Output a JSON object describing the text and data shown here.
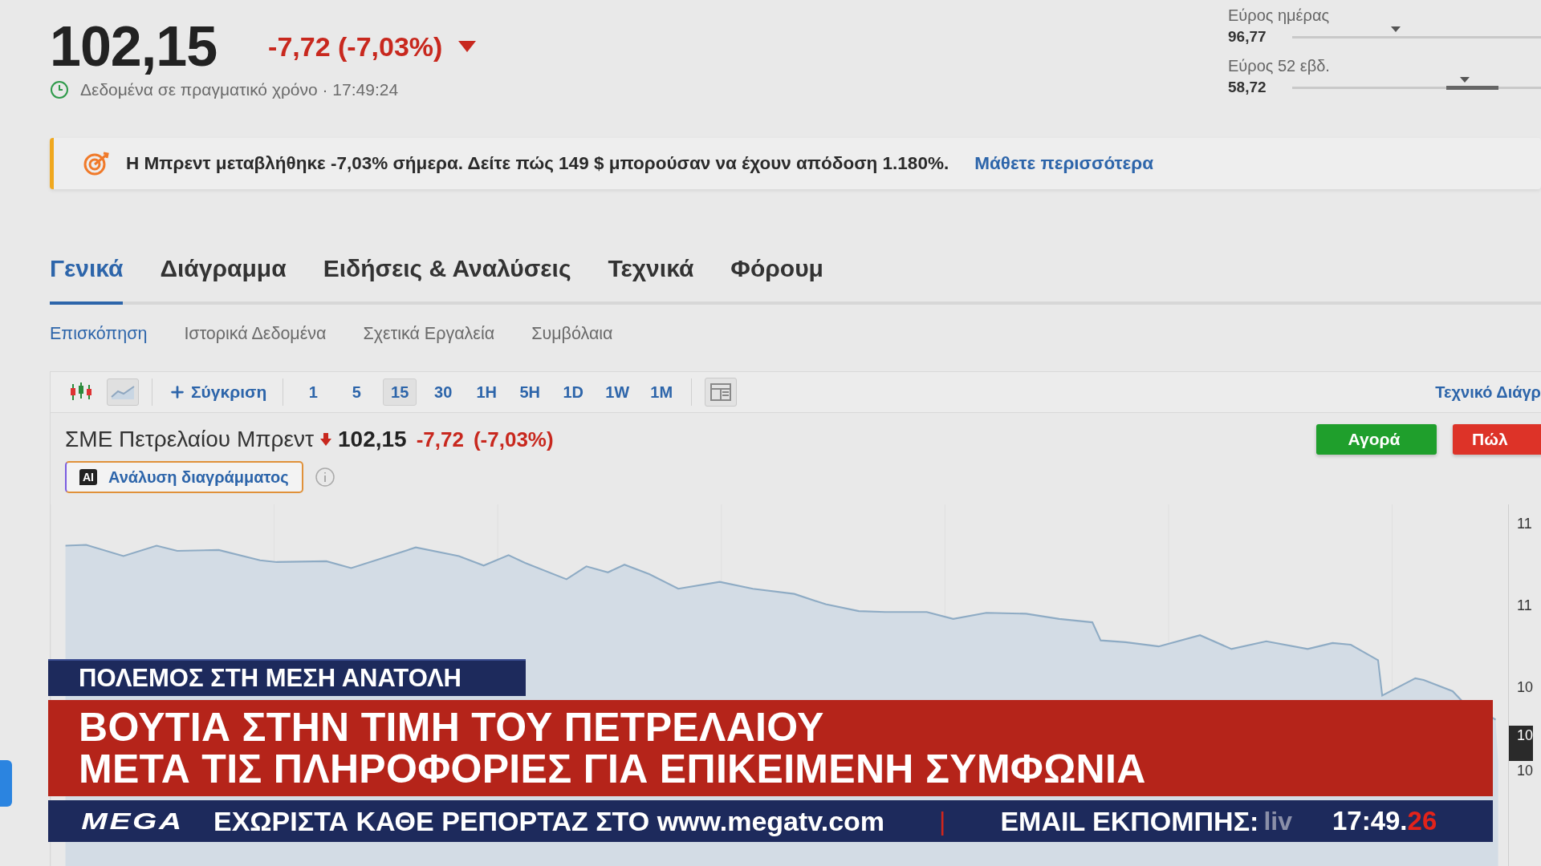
{
  "quote": {
    "price": "102,15",
    "change": "-7,72 (-7,03%)",
    "falling": true,
    "realtime_label": "Δεδομένα σε πραγματικό χρόνο · 17:49:24"
  },
  "ranges": [
    {
      "label": "Εύρος ημέρας",
      "low": "96,77",
      "kind": "marker",
      "level": 0.39
    },
    {
      "label": "Εύρος 52 εβδ.",
      "low": "58,72",
      "kind": "band",
      "level": 0.65
    }
  ],
  "promo": {
    "text": "Η Μπρεντ μεταβλήθηκε -7,03% σήμερα. Δείτε πώς 149 $ μπορούσαν να έχουν απόδοση 1.180%.",
    "link": "Μάθετε περισσότερα"
  },
  "tabs": [
    {
      "label": "Γενικά",
      "selected": true
    },
    {
      "label": "Διάγραμμα",
      "selected": false
    },
    {
      "label": "Ειδήσεις & Αναλύσεις",
      "selected": false
    },
    {
      "label": "Τεχνικά",
      "selected": false
    },
    {
      "label": "Φόρουμ",
      "selected": false
    }
  ],
  "subtabs": [
    {
      "label": "Επισκόπηση",
      "selected": true
    },
    {
      "label": "Ιστορικά Δεδομένα",
      "selected": false
    },
    {
      "label": "Σχετικά Εργαλεία",
      "selected": false
    },
    {
      "label": "Συμβόλαια",
      "selected": false
    }
  ],
  "toolbar": {
    "chart_types": [
      {
        "kind": "candles",
        "selected": false
      },
      {
        "kind": "area",
        "selected": true
      }
    ],
    "compare": "Σύγκριση",
    "intervals": [
      {
        "label": "1",
        "selected": false
      },
      {
        "label": "5",
        "selected": false
      },
      {
        "label": "15",
        "selected": true
      },
      {
        "label": "30",
        "selected": false
      },
      {
        "label": "1H",
        "selected": false
      },
      {
        "label": "5H",
        "selected": false
      },
      {
        "label": "1D",
        "selected": false
      },
      {
        "label": "1W",
        "selected": false
      },
      {
        "label": "1M",
        "selected": false
      }
    ],
    "technical_link": "Τεχνικό Διάγρ"
  },
  "instrument": {
    "name": "ΣΜΕ Πετρελαίου Μπρεντ",
    "falling": true,
    "price": "102,15",
    "change": "-7,72",
    "change_pct": "(-7,03%)"
  },
  "actions": [
    {
      "label": "Αγορά",
      "kind": "buy"
    },
    {
      "label": "Πώλ",
      "kind": "sell"
    }
  ],
  "ai_button": {
    "badge": "AI",
    "label": "Ανάλυση διαγράμματος"
  },
  "chart": {
    "y_labels": [
      {
        "label": "11",
        "kind": "tick"
      },
      {
        "label": "11",
        "kind": "tick"
      },
      {
        "label": "10",
        "kind": "tick"
      },
      {
        "label": "10",
        "kind": "current"
      },
      {
        "label": "10",
        "kind": "tick"
      }
    ]
  },
  "broadcast": {
    "topic": "ΠΟΛΕΜΟΣ ΣΤΗ ΜΕΣΗ ΑΝΑΤΟΛΗ",
    "headline": [
      "ΒΟΥΤΙΑ ΣΤΗΝ ΤΙΜΗ ΤΟΥ ΠΕΤΡΕΛΑΙΟΥ",
      "ΜΕΤΑ ΤΙΣ ΠΛΗΡΟΦΟΡΙΕΣ ΓΙΑ ΕΠΙΚΕΙΜΕΝΗ ΣΥΜΦΩΝΙΑ"
    ],
    "channel_logo": "MEGA",
    "ticker": "ΕΧΩΡΙΣΤΑ ΚΑΘΕ ΡΕΠΟΡΤΑΖ ΣΤΟ www.megatv.com",
    "separator": "|",
    "email_label": "EMAIL ΕΚΠΟΜΠΗΣ:",
    "email_partial": "liv",
    "clock": "17:49.",
    "clock_seconds": "26"
  }
}
